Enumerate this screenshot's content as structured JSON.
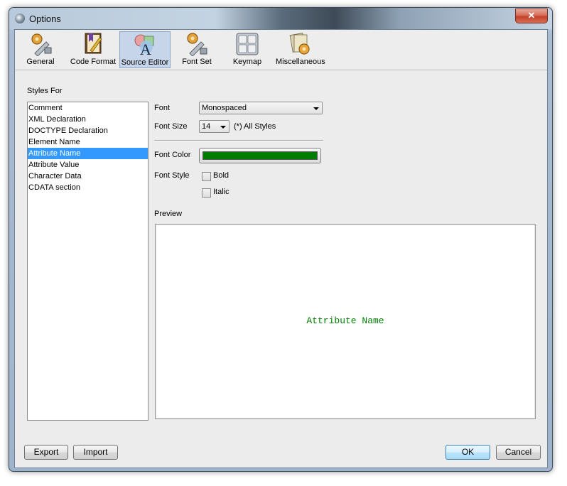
{
  "window": {
    "title": "Options",
    "close_glyph": "✕"
  },
  "toolbar": {
    "items": [
      {
        "label": "General",
        "icon": "wrench-gear-icon",
        "active": false
      },
      {
        "label": "Code Format",
        "icon": "book-pen-icon",
        "active": false
      },
      {
        "label": "Source Editor",
        "icon": "font-shapes-icon",
        "active": true
      },
      {
        "label": "Font Set",
        "icon": "font-gears-icon",
        "active": false
      },
      {
        "label": "Keymap",
        "icon": "keyboard-icon",
        "active": false
      },
      {
        "label": "Miscellaneous",
        "icon": "cards-gear-icon",
        "active": false
      }
    ]
  },
  "styles": {
    "label": "Styles For",
    "items": [
      "Comment",
      "XML Declaration",
      "DOCTYPE Declaration",
      "Element Name",
      "Attribute Name",
      "Attribute Value",
      "Character Data",
      "CDATA section"
    ],
    "selected": "Attribute Name"
  },
  "settings": {
    "font_label": "Font",
    "font_value": "Monospaced",
    "font_size_label": "Font Size",
    "font_size_value": "14",
    "all_styles_note": "(*) All Styles",
    "font_color_label": "Font Color",
    "font_color_value": "#007c00",
    "font_style_label": "Font Style",
    "bold_label": "Bold",
    "bold_checked": false,
    "italic_label": "Italic",
    "italic_checked": false
  },
  "preview": {
    "label": "Preview",
    "sample_text": "Attribute Name"
  },
  "footer": {
    "export_label": "Export",
    "import_label": "Import",
    "ok_label": "OK",
    "cancel_label": "Cancel"
  }
}
